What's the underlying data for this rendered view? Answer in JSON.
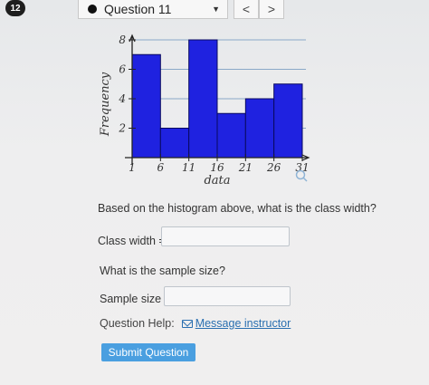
{
  "header": {
    "question_number": "12",
    "question_title": "Question 11",
    "prev_glyph": "<",
    "next_glyph": ">"
  },
  "chart_data": {
    "type": "bar",
    "bin_edges": [
      1,
      6,
      11,
      16,
      21,
      26,
      31
    ],
    "x_tick_labels": [
      "1",
      "6",
      "11",
      "16",
      "21",
      "26",
      "31"
    ],
    "values": [
      7,
      2,
      8,
      3,
      4,
      5
    ],
    "ylim": [
      0,
      8
    ],
    "y_ticks": [
      2,
      4,
      6,
      8
    ],
    "y_tick_labels": [
      "2",
      "4",
      "6",
      "8"
    ],
    "xlabel": "data",
    "ylabel": "Frequency",
    "bar_color": "#1f22e0",
    "grid": true
  },
  "question": {
    "prompt": "Based on the histogram above, what is the class width?",
    "class_width_label": "Class width =",
    "class_width_value": "",
    "sample_size_prompt": "What is the sample size?",
    "sample_size_label": "Sample size =",
    "sample_size_value": ""
  },
  "footer": {
    "help_label": "Question Help:",
    "message_link": "Message instructor",
    "submit_label": "Submit Question"
  },
  "colors": {
    "link": "#2a6fb0",
    "submit": "#4a9fe0"
  }
}
